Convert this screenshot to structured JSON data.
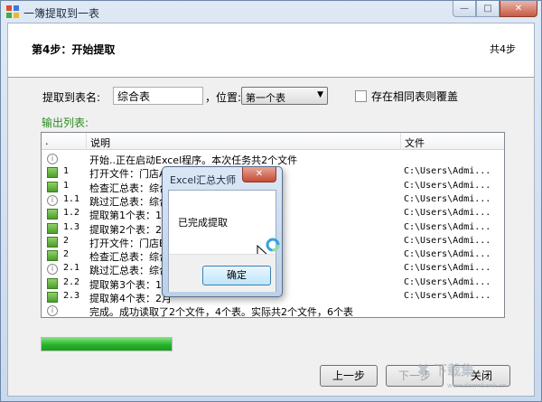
{
  "window": {
    "title": "一簿提取到一表",
    "controls": {
      "minimize": "—",
      "maximize": "□",
      "close": "✕"
    }
  },
  "header": {
    "step_title": "第4步：开始提取",
    "step_count": "共4步"
  },
  "form": {
    "sheet_label": "提取到表名:",
    "sheet_value": "综合表",
    "position_label": "，位置:",
    "position_value": "第一个表",
    "overwrite_label": "存在相同表则覆盖",
    "overwrite_checked": false
  },
  "output": {
    "label": "输出列表:",
    "columns": [
      ".",
      "说明",
      "文件"
    ],
    "rows": [
      {
        "icon": "info-icon",
        "num": "",
        "desc": "开始..正在启动Excel程序。本次任务共2个文件",
        "file": ""
      },
      {
        "icon": "green-square-icon",
        "num": "1",
        "desc": "打开文件：门店A",
        "file": "C:\\Users\\Admi..."
      },
      {
        "icon": "green-square-icon",
        "num": "1",
        "desc": "检查汇总表：综合",
        "file": "C:\\Users\\Admi..."
      },
      {
        "icon": "info-icon",
        "num": "1.1",
        "desc": "跳过汇总表：综合",
        "file": "C:\\Users\\Admi..."
      },
      {
        "icon": "green-square-icon",
        "num": "1.2",
        "desc": "提取第1个表：1月",
        "file": "C:\\Users\\Admi..."
      },
      {
        "icon": "green-square-icon",
        "num": "1.3",
        "desc": "提取第2个表：2月",
        "file": "C:\\Users\\Admi..."
      },
      {
        "icon": "green-square-icon",
        "num": "2",
        "desc": "打开文件：门店B",
        "file": "C:\\Users\\Admi..."
      },
      {
        "icon": "green-square-icon",
        "num": "2",
        "desc": "检查汇总表：综合",
        "file": "C:\\Users\\Admi..."
      },
      {
        "icon": "info-icon",
        "num": "2.1",
        "desc": "跳过汇总表：综合",
        "file": "C:\\Users\\Admi..."
      },
      {
        "icon": "green-square-icon",
        "num": "2.2",
        "desc": "提取第3个表：1月",
        "file": "C:\\Users\\Admi..."
      },
      {
        "icon": "green-square-icon",
        "num": "2.3",
        "desc": "提取第4个表：2月",
        "file": "C:\\Users\\Admi..."
      },
      {
        "icon": "info-icon",
        "num": "",
        "desc": "完成。成功读取了2个文件，4个表。实际共2个文件，6个表",
        "file": ""
      }
    ]
  },
  "progress": {
    "fraction": 1.0,
    "color": "#27b22a"
  },
  "buttons": {
    "prev": "上一步",
    "next": "下一步",
    "close": "关闭"
  },
  "dialog": {
    "title": "Excel汇总大师",
    "message": "已完成提取",
    "ok": "确定",
    "close": "✕"
  },
  "watermark": {
    "text": "下载集",
    "url": "www.downbank.cn"
  }
}
